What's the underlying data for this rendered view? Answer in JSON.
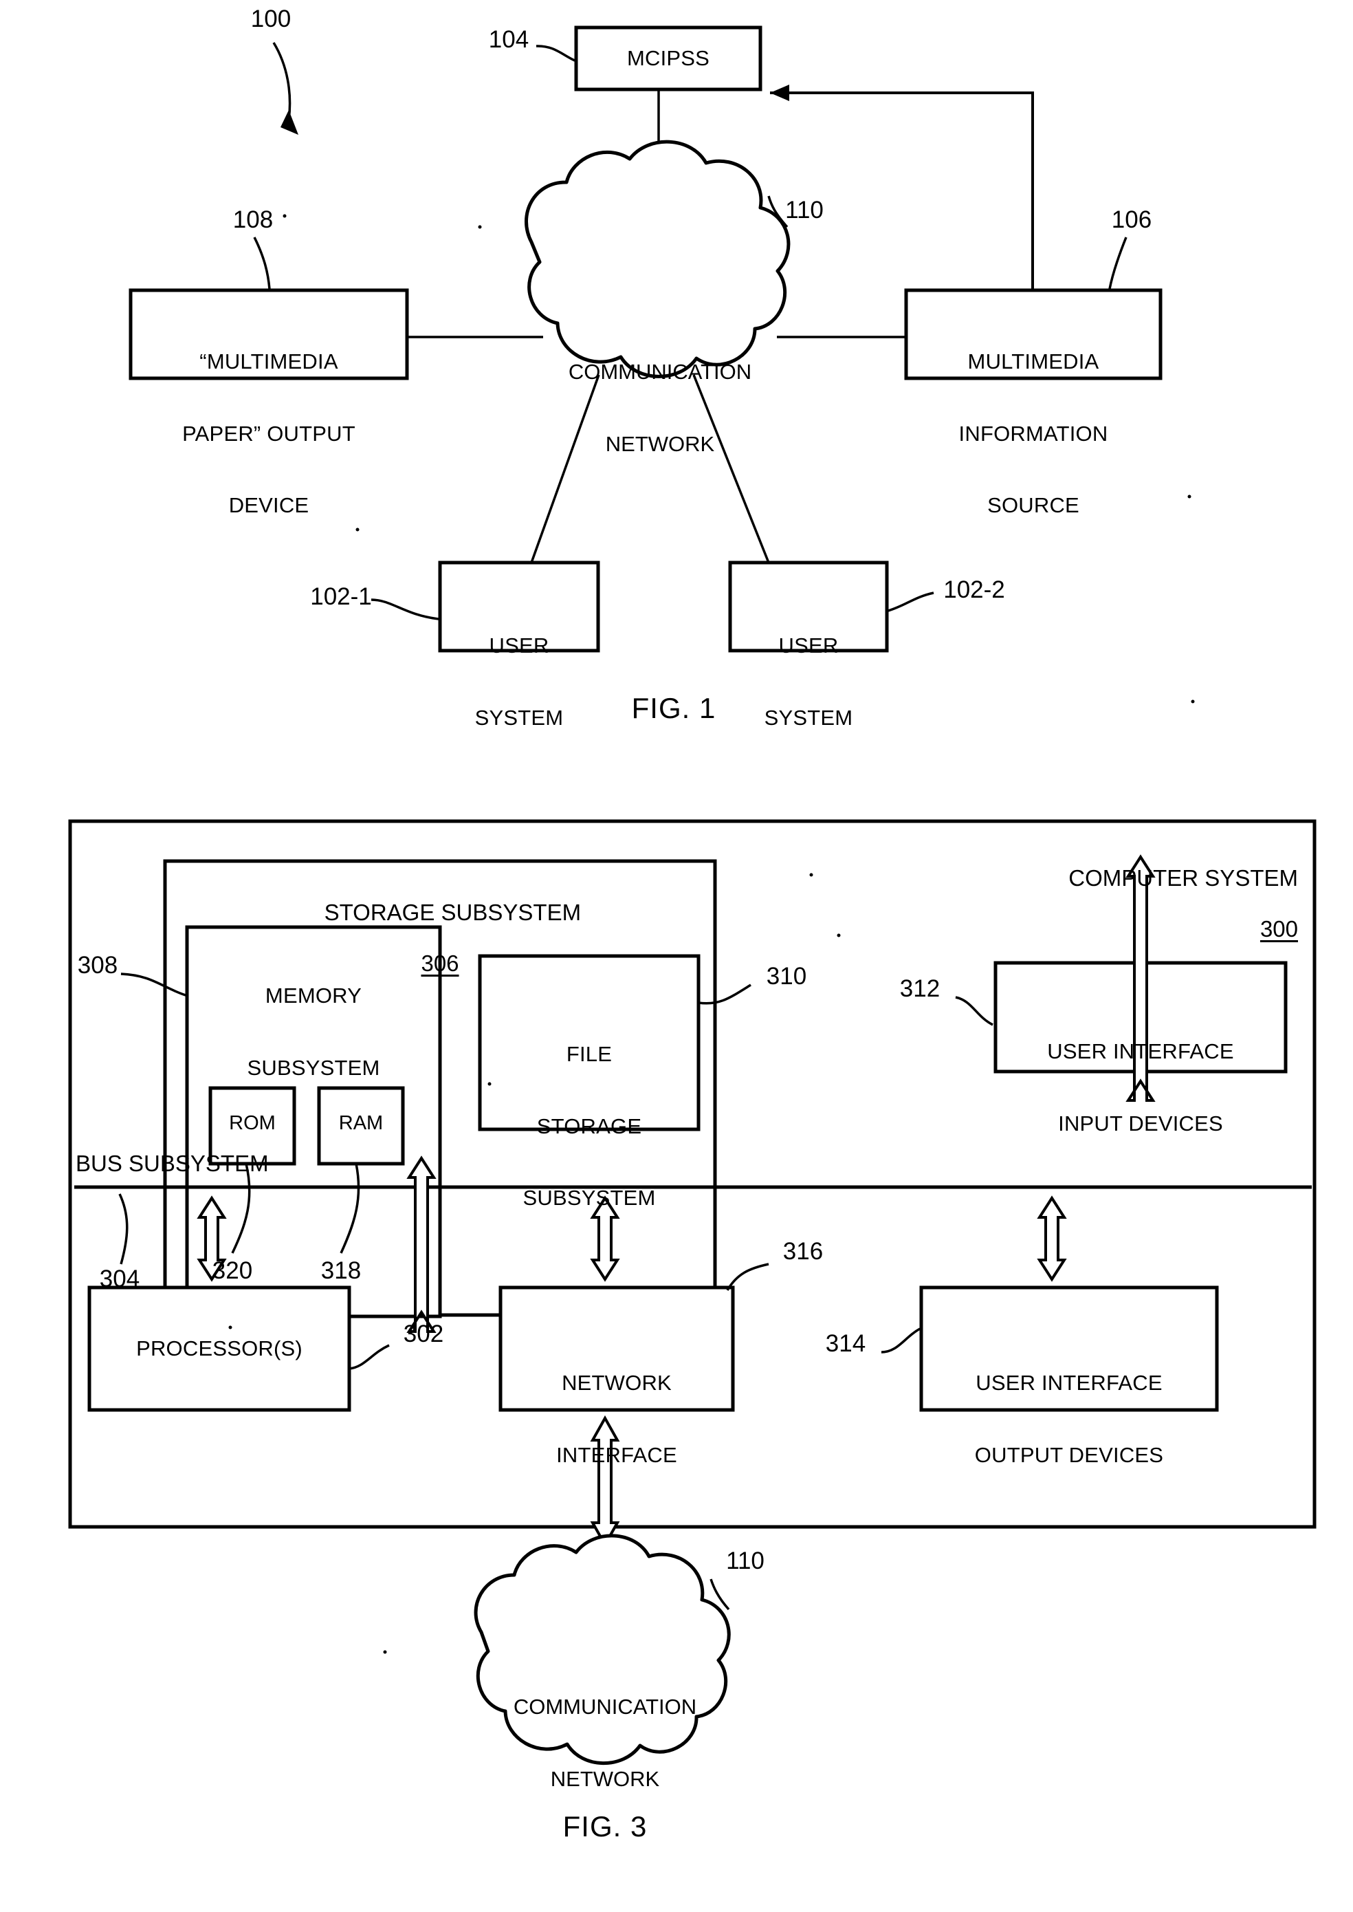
{
  "figure1": {
    "caption": "FIG. 1",
    "system_ref": "100",
    "nodes": {
      "mcipss": {
        "label": "MCIPSS",
        "ref": "104"
      },
      "cloud": {
        "line1": "COMMUNICATION",
        "line2": "NETWORK",
        "ref": "110"
      },
      "output_device": {
        "line1": "“MULTIMEDIA",
        "line2": "PAPER” OUTPUT",
        "line3": "DEVICE",
        "ref": "108"
      },
      "info_source": {
        "line1": "MULTIMEDIA",
        "line2": "INFORMATION",
        "line3": "SOURCE",
        "ref": "106"
      },
      "user_system_1": {
        "line1": "USER",
        "line2": "SYSTEM",
        "ref": "102-1"
      },
      "user_system_2": {
        "line1": "USER",
        "line2": "SYSTEM",
        "ref": "102-2"
      }
    }
  },
  "figure3": {
    "caption": "FIG. 3",
    "computer_system": {
      "label": "COMPUTER SYSTEM",
      "ref": "300"
    },
    "storage_subsystem": {
      "label": "STORAGE SUBSYSTEM",
      "ref": "306"
    },
    "memory_subsystem": {
      "line1": "MEMORY",
      "line2": "SUBSYSTEM",
      "ref": "308"
    },
    "rom": {
      "label": "ROM",
      "ref": "320"
    },
    "ram": {
      "label": "RAM",
      "ref": "318"
    },
    "file_storage": {
      "line1": "FILE",
      "line2": "STORAGE",
      "line3": "SUBSYSTEM",
      "ref": "310"
    },
    "ui_input": {
      "line1": "USER INTERFACE",
      "line2": "INPUT DEVICES",
      "ref": "312"
    },
    "ui_output": {
      "line1": "USER INTERFACE",
      "line2": "OUTPUT DEVICES",
      "ref": "314"
    },
    "bus": {
      "label": "BUS SUBSYSTEM",
      "ref": "304"
    },
    "processors": {
      "label": "PROCESSOR(S)",
      "ref": "302"
    },
    "network_interface": {
      "line1": "NETWORK",
      "line2": "INTERFACE",
      "ref": "316"
    },
    "cloud": {
      "line1": "COMMUNICATION",
      "line2": "NETWORK",
      "ref": "110"
    }
  },
  "colors": {
    "ink": "#000000",
    "paper": "#ffffff"
  }
}
